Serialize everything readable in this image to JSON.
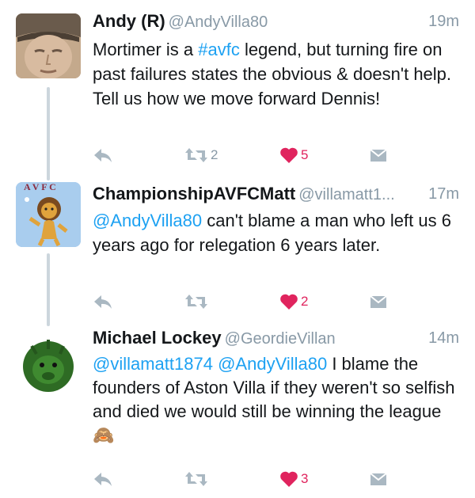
{
  "tweets": [
    {
      "name": "Andy (R)",
      "handle": "@AndyVilla80",
      "time": "19m",
      "body_pre": "Mortimer is a ",
      "hashtag": "#avfc",
      "body_post": " legend, but turning fire on past failures states the obvious & doesn't help. Tell us how we move forward Dennis!",
      "retweets": "2",
      "likes": "5",
      "avatar_icon": "man-face-cap-avatar"
    },
    {
      "name": "ChampionshipAVFCMatt",
      "handle": "@villamatt1...",
      "time": "17m",
      "mention": "@AndyVilla80",
      "body": " can't blame a man who left us 6 years ago for relegation 6 years later.",
      "retweets": "",
      "likes": "2",
      "avatar_icon": "cartoon-lion-avatar"
    },
    {
      "name": "Michael Lockey",
      "handle": "@GeordieVillan",
      "time": "14m",
      "mention1": "@villamatt1874",
      "mention2": "@AndyVilla80",
      "body": " I blame the founders of Aston Villa if they weren't so selfish and died we would still be winning the league ",
      "emoji": "🙈",
      "retweets": "",
      "likes": "3",
      "avatar_icon": "baby-gorilla-avatar"
    }
  ],
  "colors": {
    "link": "#1da1f2",
    "like": "#e0245e",
    "muted": "#8899a6",
    "text": "#14171a"
  },
  "action_icons": [
    "reply-icon",
    "retweet-icon",
    "heart-icon",
    "dm-envelope-icon"
  ]
}
